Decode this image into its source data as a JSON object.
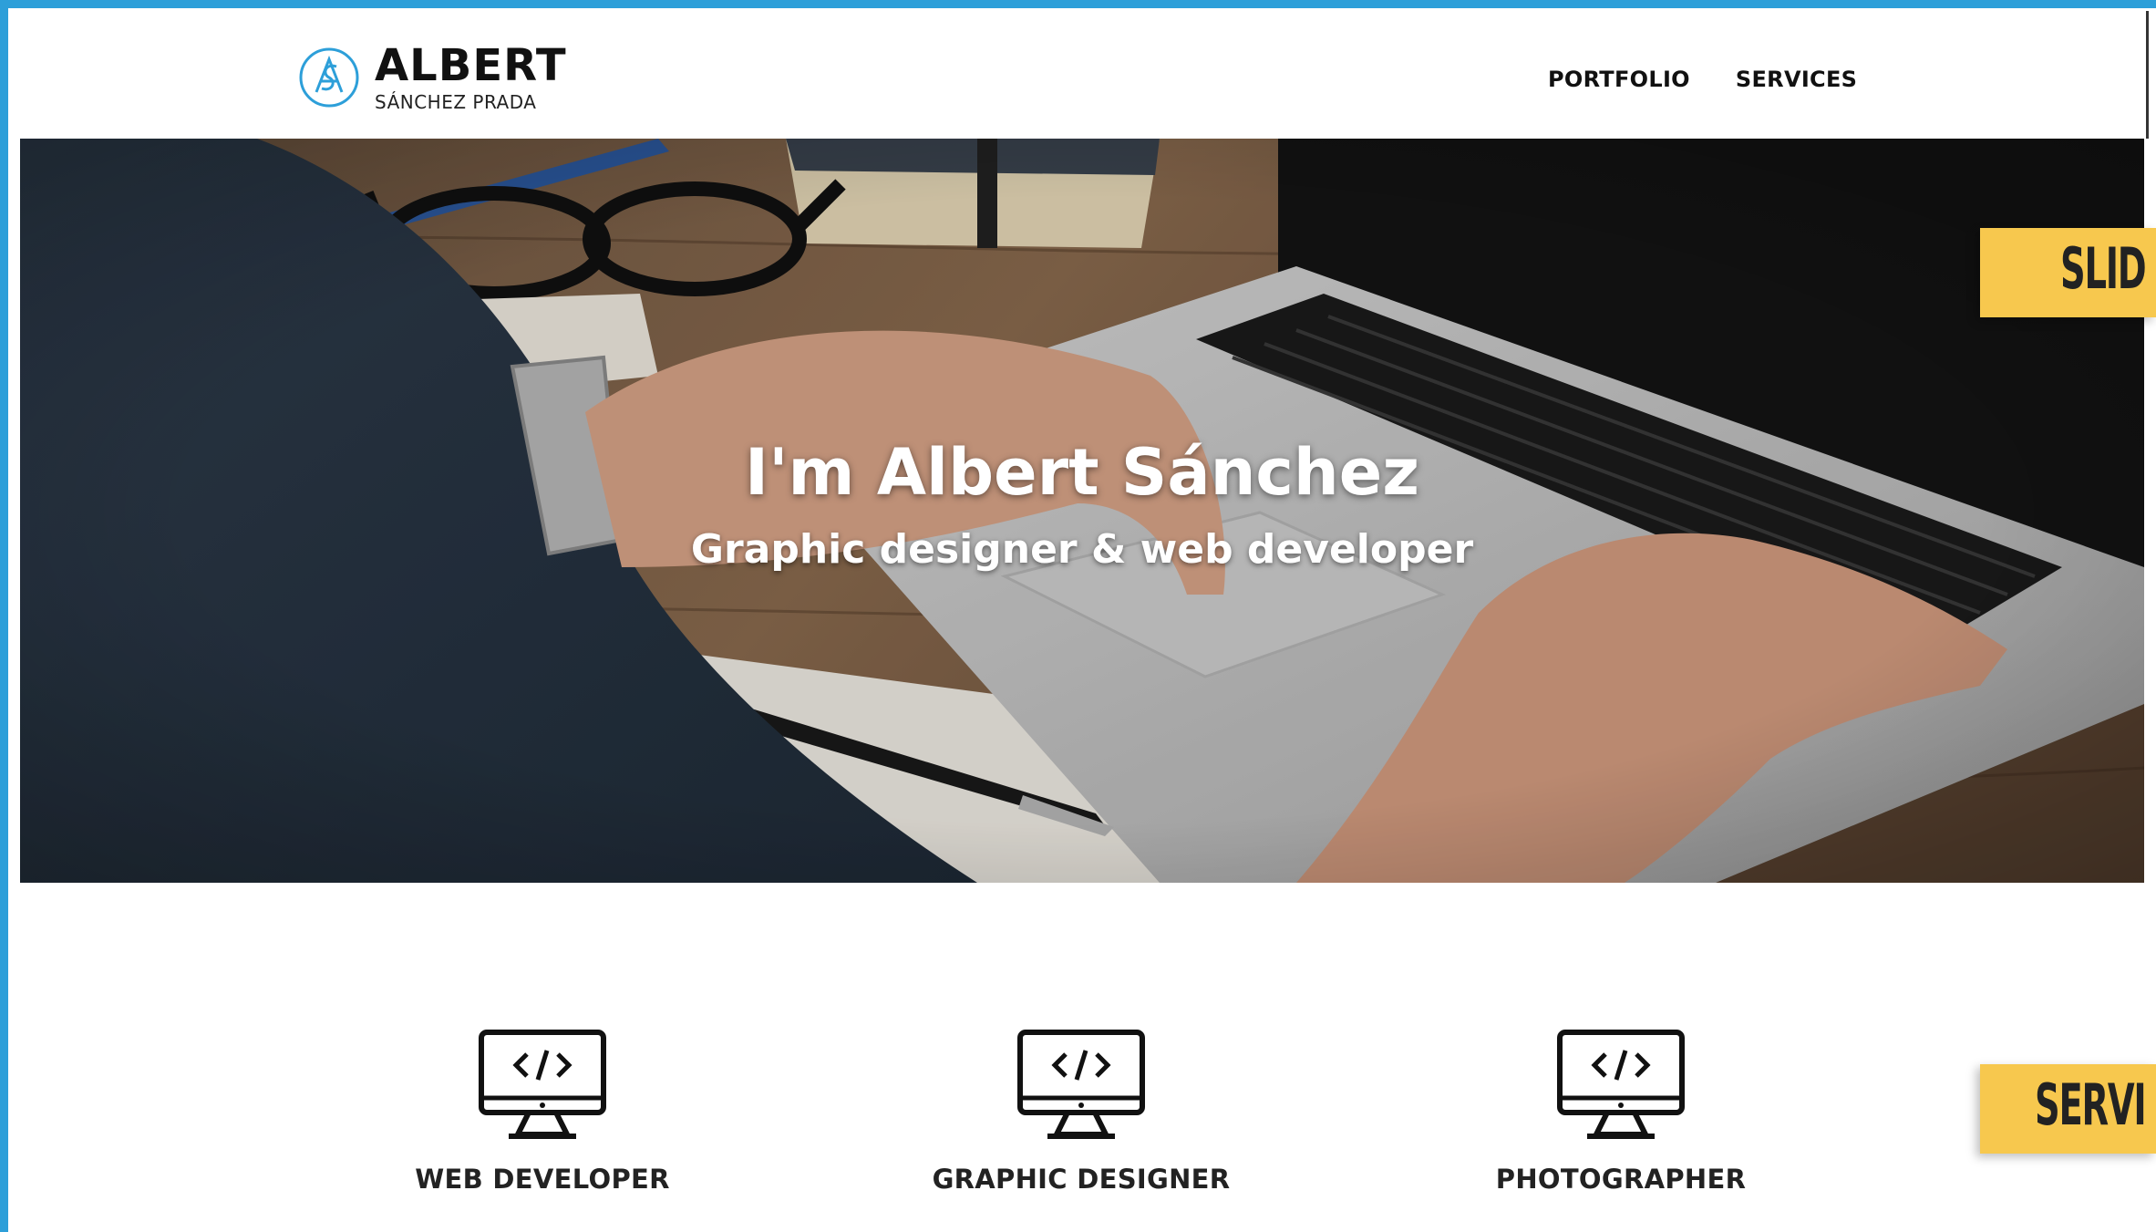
{
  "brand": {
    "name": "ALBERT",
    "subtitle": "SÁNCHEZ PRADA",
    "colors": {
      "frame": "#2d9fd9",
      "accent": "#f7c84e"
    }
  },
  "nav": {
    "items": [
      {
        "label": "PORTFOLIO"
      },
      {
        "label": "SERVICES"
      }
    ]
  },
  "hero": {
    "title": "I'm Albert Sánchez",
    "subtitle": "Graphic designer & web developer"
  },
  "side_tags": {
    "slider": "SLID",
    "services": "SERVI"
  },
  "services": [
    {
      "title": "WEB DEVELOPER",
      "icon": "code-monitor-icon"
    },
    {
      "title": "GRAPHIC DESIGNER",
      "icon": "code-monitor-icon"
    },
    {
      "title": "PHOTOGRAPHER",
      "icon": "code-monitor-icon"
    }
  ]
}
